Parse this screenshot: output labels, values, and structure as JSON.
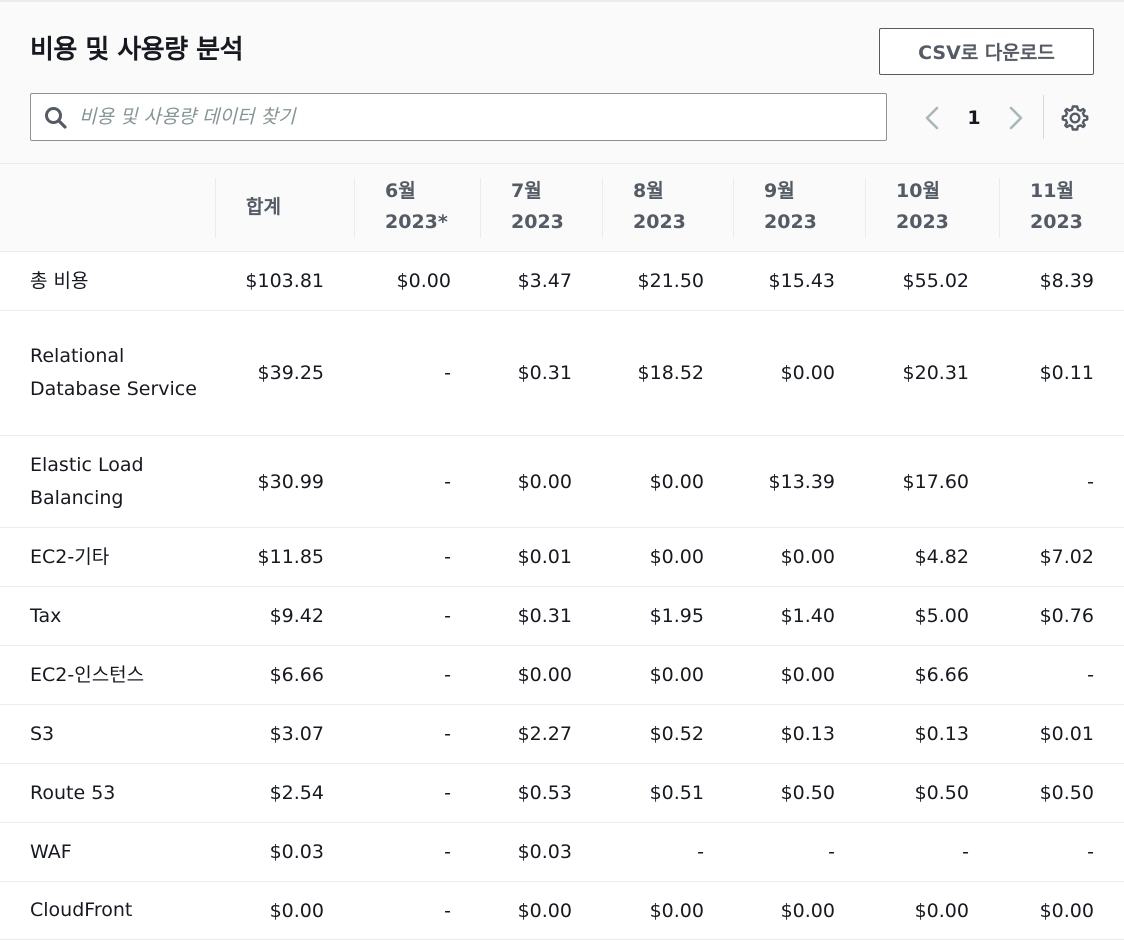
{
  "header": {
    "title": "비용 및 사용량 분석",
    "csv_button_label": "CSV로 다운로드",
    "search_placeholder": "비용 및 사용량 데이터 찾기",
    "current_page": "1"
  },
  "table": {
    "columns": [
      {
        "line1": "",
        "line2": ""
      },
      {
        "line1": "합계",
        "line2": ""
      },
      {
        "line1": "6월",
        "line2": "2023*"
      },
      {
        "line1": "7월",
        "line2": "2023"
      },
      {
        "line1": "8월",
        "line2": "2023"
      },
      {
        "line1": "9월",
        "line2": "2023"
      },
      {
        "line1": "10월",
        "line2": "2023"
      },
      {
        "line1": "11월",
        "line2": "2023"
      }
    ],
    "rows": [
      {
        "name": "총 비용",
        "values": [
          "$103.81",
          "$0.00",
          "$3.47",
          "$21.50",
          "$15.43",
          "$55.02",
          "$8.39"
        ]
      },
      {
        "name": "Relational Database Service",
        "values": [
          "$39.25",
          "-",
          "$0.31",
          "$18.52",
          "$0.00",
          "$20.31",
          "$0.11"
        ]
      },
      {
        "name": "Elastic Load Balancing",
        "values": [
          "$30.99",
          "-",
          "$0.00",
          "$0.00",
          "$13.39",
          "$17.60",
          "-"
        ]
      },
      {
        "name": "EC2-기타",
        "values": [
          "$11.85",
          "-",
          "$0.01",
          "$0.00",
          "$0.00",
          "$4.82",
          "$7.02"
        ]
      },
      {
        "name": "Tax",
        "values": [
          "$9.42",
          "-",
          "$0.31",
          "$1.95",
          "$1.40",
          "$5.00",
          "$0.76"
        ]
      },
      {
        "name": "EC2-인스턴스",
        "values": [
          "$6.66",
          "-",
          "$0.00",
          "$0.00",
          "$0.00",
          "$6.66",
          "-"
        ]
      },
      {
        "name": "S3",
        "values": [
          "$3.07",
          "-",
          "$2.27",
          "$0.52",
          "$0.13",
          "$0.13",
          "$0.01"
        ]
      },
      {
        "name": "Route 53",
        "values": [
          "$2.54",
          "-",
          "$0.53",
          "$0.51",
          "$0.50",
          "$0.50",
          "$0.50"
        ]
      },
      {
        "name": "WAF",
        "values": [
          "$0.03",
          "-",
          "$0.03",
          "-",
          "-",
          "-",
          "-"
        ]
      },
      {
        "name": "CloudFront",
        "values": [
          "$0.00",
          "-",
          "$0.00",
          "$0.00",
          "$0.00",
          "$0.00",
          "$0.00"
        ]
      }
    ]
  },
  "icons": {
    "search": "search-icon",
    "prev": "chevron-left-icon",
    "next": "chevron-right-icon",
    "settings": "gear-icon"
  },
  "colors": {
    "header_bg": "#fafafa",
    "text": "#16191f",
    "muted": "#545b64",
    "border": "#eaeded",
    "pager_disabled": "#aab7b8"
  }
}
